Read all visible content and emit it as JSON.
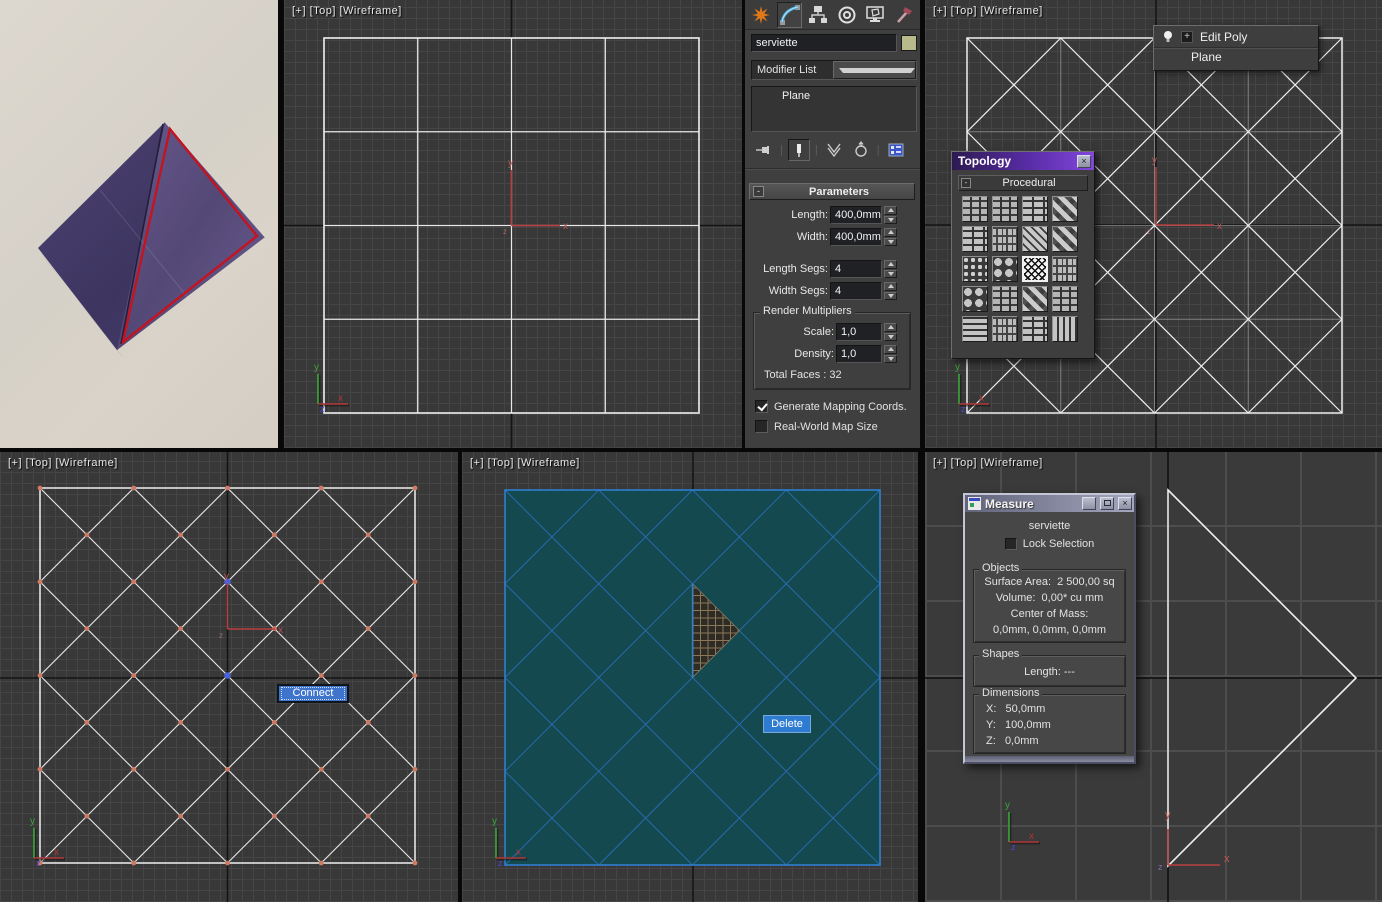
{
  "viewport_label": "[+] [Top] [Wireframe]",
  "axis_labels": {
    "x": "x",
    "y": "y",
    "z": "z"
  },
  "glyphs": {
    "close": "×",
    "plus": "+",
    "minus": "-"
  },
  "colors": {
    "accent_blue": "#3f74cc",
    "teal_plane": "#14494f",
    "topology_title": "#5a2da8",
    "object_swatch": "#b9ba8b",
    "vertex": "#cf7a62",
    "vertex_selected": "#4663e0"
  },
  "command_panel": {
    "tabs": [
      "Create",
      "Modify",
      "Hierarchy",
      "Motion",
      "Display",
      "Utilities"
    ],
    "selected_tab": "Modify",
    "object_name": "serviette",
    "modifier_list": "Modifier List",
    "stack_items": [
      "Plane"
    ],
    "parameters": {
      "title": "Parameters",
      "length_label": "Length:",
      "length_value": "400,0mm",
      "width_label": "Width:",
      "width_value": "400,0mm",
      "length_segs_label": "Length Segs:",
      "length_segs_value": "4",
      "width_segs_label": "Width Segs:",
      "width_segs_value": "4",
      "render_multipliers_title": "Render Multipliers",
      "scale_label": "Scale:",
      "scale_value": "1,0",
      "density_label": "Density:",
      "density_value": "1,0",
      "total_faces": "Total Faces : 32",
      "generate_mapping": "Generate Mapping Coords.",
      "real_world": "Real-World Map Size"
    }
  },
  "modifier_popup": {
    "selected": "Edit Poly",
    "below": "Plane"
  },
  "topology": {
    "title": "Topology",
    "rollout": "Procedural",
    "patterns": [
      {
        "name": "city-blocks",
        "selected": false
      },
      {
        "name": "pavers",
        "selected": false
      },
      {
        "name": "bricks",
        "selected": false
      },
      {
        "name": "diamond-weave",
        "selected": false
      },
      {
        "name": "bricks-offset",
        "selected": false
      },
      {
        "name": "tiles-random",
        "selected": false
      },
      {
        "name": "hatch-diagonal",
        "selected": false
      },
      {
        "name": "diamonds-small",
        "selected": false
      },
      {
        "name": "gravel",
        "selected": false
      },
      {
        "name": "stones",
        "selected": false
      },
      {
        "name": "crosshatch",
        "selected": true
      },
      {
        "name": "curved-maze",
        "selected": false
      },
      {
        "name": "shattered",
        "selected": false
      },
      {
        "name": "grid-blocks",
        "selected": false
      },
      {
        "name": "flagstone",
        "selected": false
      },
      {
        "name": "cross-tiles",
        "selected": false
      },
      {
        "name": "planks-horizontal",
        "selected": false
      },
      {
        "name": "planks-broken",
        "selected": false
      },
      {
        "name": "rails",
        "selected": false
      },
      {
        "name": "planks-vertical",
        "selected": false
      }
    ]
  },
  "tools": {
    "connect": "Connect",
    "delete": "Delete"
  },
  "measure": {
    "title": "Measure",
    "object_name": "serviette",
    "lock_selection": "Lock Selection",
    "objects_title": "Objects",
    "objects_rows": [
      "Surface Area:  2 500,00 sq",
      "Volume:  0,00* cu mm",
      "Center of Mass:",
      "0,0mm, 0,0mm, 0,0mm"
    ],
    "shapes_title": "Shapes",
    "shapes_rows": [
      "Length: ---"
    ],
    "dimensions_title": "Dimensions",
    "dimensions_rows": [
      "X:   50,0mm",
      "Y:   100,0mm",
      "Z:   0,0mm"
    ]
  }
}
